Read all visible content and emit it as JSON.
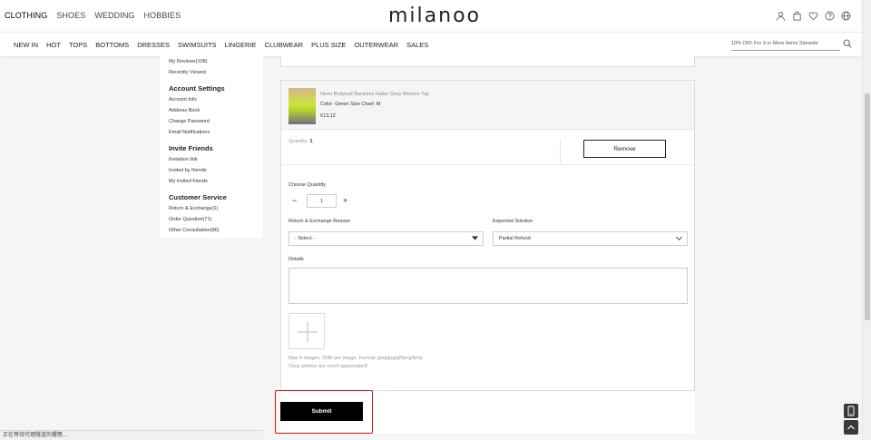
{
  "header": {
    "categories": [
      {
        "label": "CLOTHING",
        "active": true
      },
      {
        "label": "SHOES",
        "active": false
      },
      {
        "label": "WEDDING",
        "active": false
      },
      {
        "label": "HOBBIES",
        "active": false
      }
    ],
    "logo": "milanoo",
    "icons": [
      "user-icon",
      "bag-icon",
      "heart-icon",
      "help-icon",
      "globe-icon"
    ]
  },
  "nav": {
    "items": [
      "NEW IN",
      "HOT",
      "TOPS",
      "BOTTOMS",
      "DRESSES",
      "SWIMSUITS",
      "LINGERIE",
      "CLUBWEAR",
      "PLUS SIZE",
      "OUTERWEAR",
      "SALES"
    ],
    "search_placeholder": "10% OFF For 3 or More Items Sitewide"
  },
  "sidebar": {
    "top_links": [
      "My Reviews(108)",
      "Recently Viewed"
    ],
    "sections": [
      {
        "title": "Account Settings",
        "links": [
          "Account Info",
          "Address Book",
          "Change Password",
          "Email Notifications"
        ]
      },
      {
        "title": "Invite Friends",
        "links": [
          "Invitation link",
          "Invited by friends",
          "My invited friends"
        ]
      },
      {
        "title": "Customer Service",
        "links": [
          "Return & Exchange(1)",
          "Order Question(71)",
          "Other Consultation(86)"
        ]
      }
    ]
  },
  "product": {
    "name": "Neon Bodysuit Backless Halter Sexy Women Top",
    "attributes": "Color: Green  Size Chart: M",
    "price": "€13,12",
    "quantity_label": "Quantity:",
    "quantity_value": "1",
    "remove_label": "Remove"
  },
  "form": {
    "choose_quantity_label": "Choose Quantity",
    "quantity_value": "1",
    "minus": "−",
    "plus": "+",
    "reason_label": "Return & Exchange Reason",
    "reason_value": "- Select -",
    "solution_label": "Expected Solution",
    "solution_value": "Partial Refund",
    "details_label": "Details",
    "upload_hint_1": "Max 4 images, 5MB per image.  Format: jpeg/jpg/gif/png/bmp",
    "upload_hint_2": "Clear photos are much appreciated!",
    "submit_label": "Submit"
  },
  "status_bar": {
    "text": "正在等待代理隧道的響應..."
  },
  "colors": {
    "accent": "#000000",
    "highlight": "#e01010"
  }
}
